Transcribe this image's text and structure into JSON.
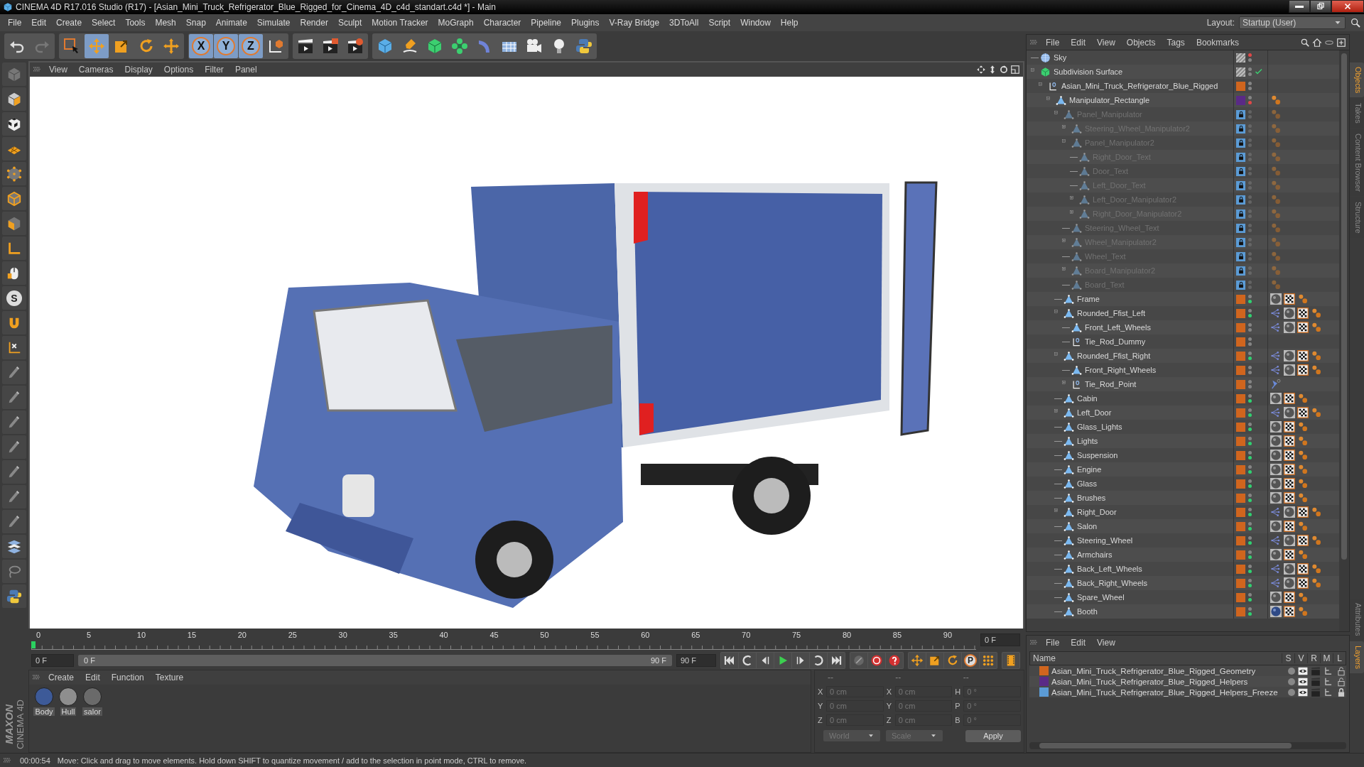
{
  "window": {
    "title": "CINEMA 4D R17.016 Studio (R17) - [Asian_Mini_Truck_Refrigerator_Blue_Rigged_for_Cinema_4D_c4d_standart.c4d *] - Main"
  },
  "menu": [
    "File",
    "Edit",
    "Create",
    "Select",
    "Tools",
    "Mesh",
    "Snap",
    "Animate",
    "Simulate",
    "Render",
    "Sculpt",
    "Motion Tracker",
    "MoGraph",
    "Character",
    "Pipeline",
    "Plugins",
    "V-Ray Bridge",
    "3DToAll",
    "Script",
    "Window",
    "Help"
  ],
  "layout": {
    "label": "Layout:",
    "value": "Startup (User)"
  },
  "toolbar": [
    {
      "kind": "undo",
      "selected": false
    },
    {
      "kind": "redo",
      "selected": false
    },
    {
      "kind": "select",
      "selected": false
    },
    {
      "kind": "move",
      "selected": true
    },
    {
      "kind": "scale",
      "selected": false
    },
    {
      "kind": "rotate",
      "selected": false
    },
    {
      "kind": "transform",
      "selected": false
    },
    {
      "kind": "axis",
      "label": "X",
      "selected": true
    },
    {
      "kind": "axis",
      "label": "Y",
      "selected": true
    },
    {
      "kind": "axis",
      "label": "Z",
      "selected": true
    },
    {
      "kind": "coord",
      "selected": false
    },
    {
      "kind": "render",
      "selected": false
    },
    {
      "kind": "render_view",
      "selected": false
    },
    {
      "kind": "render_settings",
      "selected": false
    },
    {
      "kind": "cube",
      "selected": false
    },
    {
      "kind": "pen",
      "selected": false
    },
    {
      "kind": "subdiv",
      "selected": false
    },
    {
      "kind": "cloner",
      "selected": false
    },
    {
      "kind": "bend",
      "selected": false
    },
    {
      "kind": "floor",
      "selected": false
    },
    {
      "kind": "camera",
      "selected": false
    },
    {
      "kind": "light",
      "selected": false
    },
    {
      "kind": "python",
      "selected": false
    }
  ],
  "left_tools": [
    {
      "kind": "grey_cube"
    },
    {
      "kind": "model"
    },
    {
      "kind": "texture"
    },
    {
      "kind": "workplane"
    },
    {
      "kind": "points"
    },
    {
      "kind": "edges"
    },
    {
      "kind": "polygons"
    },
    {
      "kind": "axis_l"
    },
    {
      "kind": "mouse"
    },
    {
      "kind": "solo",
      "label": "S"
    },
    {
      "kind": "magnet"
    },
    {
      "kind": "axis_lock"
    },
    {
      "kind": "brush"
    },
    {
      "kind": "brush"
    },
    {
      "kind": "brush"
    },
    {
      "kind": "brush"
    },
    {
      "kind": "brush"
    },
    {
      "kind": "brush"
    },
    {
      "kind": "brush"
    },
    {
      "kind": "checker_grid"
    },
    {
      "kind": "lasso"
    },
    {
      "kind": "python"
    }
  ],
  "viewport": {
    "menu": [
      "View",
      "Cameras",
      "Display",
      "Options",
      "Filter",
      "Panel"
    ]
  },
  "timeline": {
    "ticks": [
      "0",
      "5",
      "10",
      "15",
      "20",
      "25",
      "30",
      "35",
      "40",
      "45",
      "50",
      "55",
      "60",
      "65",
      "70",
      "75",
      "80",
      "85",
      "90"
    ],
    "level": 0,
    "frame": "0 F"
  },
  "transport": {
    "start": "0 F",
    "range": {
      "start": "0 F",
      "end": "90 F",
      "level": 1
    },
    "end": "90 F",
    "buttons": [
      {
        "kind": "first"
      },
      {
        "kind": "prev_key"
      },
      {
        "kind": "prev"
      },
      {
        "kind": "play"
      },
      {
        "kind": "next"
      },
      {
        "kind": "next_key"
      },
      {
        "kind": "last"
      },
      {
        "kind": "record_off"
      },
      {
        "kind": "record"
      },
      {
        "kind": "autokey"
      },
      {
        "kind": "move"
      },
      {
        "kind": "scale"
      },
      {
        "kind": "rotate"
      },
      {
        "kind": "param",
        "label": "P"
      },
      {
        "kind": "grid_dots"
      },
      {
        "kind": "film"
      }
    ]
  },
  "materials": {
    "menu": [
      "Create",
      "Edit",
      "Function",
      "Texture"
    ],
    "items": [
      {
        "name": "Body",
        "color": "#3d5a98"
      },
      {
        "name": "Hull",
        "color": "#8e8e8e"
      },
      {
        "name": "salor",
        "color": "#6a6a6a"
      }
    ]
  },
  "coordinates": {
    "headers": [
      "--",
      "--",
      "--"
    ],
    "rows": [
      [
        {
          "label": "X",
          "value": "0 cm"
        },
        {
          "label": "X",
          "value": "0 cm"
        },
        {
          "label": "H",
          "value": "0 °"
        }
      ],
      [
        {
          "label": "Y",
          "value": "0 cm"
        },
        {
          "label": "Y",
          "value": "0 cm"
        },
        {
          "label": "P",
          "value": "0 °"
        }
      ],
      [
        {
          "label": "Z",
          "value": "0 cm"
        },
        {
          "label": "Z",
          "value": "0 cm"
        },
        {
          "label": "B",
          "value": "0 °"
        }
      ]
    ],
    "modes": [
      "World",
      "Scale"
    ],
    "apply": "Apply"
  },
  "objects": {
    "menu": [
      "File",
      "Edit",
      "View",
      "Objects",
      "Tags",
      "Bookmarks"
    ],
    "tree": [
      {
        "name": "Sky",
        "kind": "sky",
        "disabled": false,
        "editor_off": true,
        "render_on": false,
        "render_off": false
      },
      {
        "name": "Subdivision Surface",
        "kind": "subdiv",
        "expanded": true,
        "disabled": false,
        "editor_off": false,
        "render_on": false,
        "render_off": false,
        "children": [
          {
            "name": "Asian_Mini_Truck_Refrigerator_Blue_Rigged",
            "kind": "null",
            "expanded": true,
            "color": "#d0651e",
            "disabled": false,
            "editor_off": false,
            "render_on": false,
            "render_off": false,
            "children": [
              {
                "name": "Manipulator_Rectangle",
                "kind": "polygon",
                "expanded": true,
                "color": "#5a2a86",
                "disabled": false,
                "editor_off": false,
                "render_on": false,
                "render_off": true,
                "tags": [
                  {
                    "kind": "balls"
                  }
                ],
                "children": [
                  {
                    "name": "Panel_Manipulator",
                    "kind": "polygon",
                    "expanded": true,
                    "color": "#5b9bd5",
                    "disabled": true,
                    "editor_off": false,
                    "render_on": false,
                    "render_off": false,
                    "tags": [
                      {
                        "kind": "balls"
                      }
                    ],
                    "children": [
                      {
                        "name": "Steering_Wheel_Manipulator2",
                        "kind": "polygon",
                        "expanded": false,
                        "color": "#5b9bd5",
                        "disabled": true,
                        "editor_off": false,
                        "render_on": false,
                        "render_off": false,
                        "tags": [
                          {
                            "kind": "balls"
                          }
                        ]
                      },
                      {
                        "name": "Panel_Manipulator2",
                        "kind": "polygon",
                        "expanded": true,
                        "color": "#5b9bd5",
                        "disabled": true,
                        "editor_off": false,
                        "render_on": false,
                        "render_off": false,
                        "tags": [
                          {
                            "kind": "balls"
                          }
                        ],
                        "children": [
                          {
                            "name": "Right_Door_Text",
                            "kind": "polygon",
                            "color": "#5b9bd5",
                            "disabled": true,
                            "editor_off": false,
                            "render_on": false,
                            "render_off": false,
                            "tags": [
                              {
                                "kind": "balls"
                              }
                            ]
                          },
                          {
                            "name": "Door_Text",
                            "kind": "polygon",
                            "color": "#5b9bd5",
                            "disabled": true,
                            "editor_off": false,
                            "render_on": false,
                            "render_off": false,
                            "tags": [
                              {
                                "kind": "balls"
                              }
                            ]
                          },
                          {
                            "name": "Left_Door_Text",
                            "kind": "polygon",
                            "color": "#5b9bd5",
                            "disabled": true,
                            "editor_off": false,
                            "render_on": false,
                            "render_off": false,
                            "tags": [
                              {
                                "kind": "balls"
                              }
                            ]
                          },
                          {
                            "name": "Left_Door_Manipulator2",
                            "kind": "polygon",
                            "expanded": false,
                            "color": "#5b9bd5",
                            "disabled": true,
                            "editor_off": false,
                            "render_on": false,
                            "render_off": false,
                            "tags": [
                              {
                                "kind": "balls"
                              }
                            ]
                          },
                          {
                            "name": "Right_Door_Manipulator2",
                            "kind": "polygon",
                            "expanded": false,
                            "color": "#5b9bd5",
                            "disabled": true,
                            "editor_off": false,
                            "render_on": false,
                            "render_off": false,
                            "tags": [
                              {
                                "kind": "balls"
                              }
                            ]
                          }
                        ]
                      },
                      {
                        "name": "Steering_Wheel_Text",
                        "kind": "polygon",
                        "color": "#5b9bd5",
                        "disabled": true,
                        "editor_off": false,
                        "render_on": false,
                        "render_off": false,
                        "tags": [
                          {
                            "kind": "balls"
                          }
                        ]
                      },
                      {
                        "name": "Wheel_Manipulator2",
                        "kind": "polygon",
                        "expanded": false,
                        "color": "#5b9bd5",
                        "disabled": true,
                        "editor_off": false,
                        "render_on": false,
                        "render_off": false,
                        "tags": [
                          {
                            "kind": "balls"
                          }
                        ]
                      },
                      {
                        "name": "Wheel_Text",
                        "kind": "polygon",
                        "color": "#5b9bd5",
                        "disabled": true,
                        "editor_off": false,
                        "render_on": false,
                        "render_off": false,
                        "tags": [
                          {
                            "kind": "balls"
                          }
                        ]
                      },
                      {
                        "name": "Board_Manipulator2",
                        "kind": "polygon",
                        "expanded": false,
                        "color": "#5b9bd5",
                        "disabled": true,
                        "editor_off": false,
                        "render_on": false,
                        "render_off": false,
                        "tags": [
                          {
                            "kind": "balls"
                          }
                        ]
                      },
                      {
                        "name": "Board_Text",
                        "kind": "polygon",
                        "color": "#5b9bd5",
                        "disabled": true,
                        "editor_off": false,
                        "render_on": false,
                        "render_off": false,
                        "tags": [
                          {
                            "kind": "balls"
                          }
                        ]
                      }
                    ]
                  },
                  {
                    "name": "Frame",
                    "kind": "polygon",
                    "color": "#d0651e",
                    "disabled": false,
                    "editor_off": false,
                    "render_on": true,
                    "render_off": false,
                    "tags": [
                      {
                        "kind": "material"
                      },
                      {
                        "kind": "texture"
                      },
                      {
                        "kind": "balls"
                      }
                    ]
                  },
                  {
                    "name": "Rounded_Ffist_Left",
                    "kind": "polygon",
                    "expanded": true,
                    "color": "#d0651e",
                    "disabled": false,
                    "editor_off": false,
                    "render_on": true,
                    "render_off": false,
                    "tags": [
                      {
                        "kind": "weight"
                      },
                      {
                        "kind": "material"
                      },
                      {
                        "kind": "texture"
                      },
                      {
                        "kind": "balls"
                      }
                    ],
                    "children": [
                      {
                        "name": "Front_Left_Wheels",
                        "kind": "polygon",
                        "color": "#d0651e",
                        "disabled": false,
                        "editor_off": false,
                        "render_on": false,
                        "render_off": false,
                        "tags": [
                          {
                            "kind": "weight"
                          },
                          {
                            "kind": "material"
                          },
                          {
                            "kind": "texture"
                          },
                          {
                            "kind": "balls"
                          }
                        ]
                      },
                      {
                        "name": "Tie_Rod_Dummy",
                        "kind": "null",
                        "color": "#d0651e",
                        "disabled": false,
                        "editor_off": false,
                        "render_on": false,
                        "render_off": false
                      }
                    ]
                  },
                  {
                    "name": "Rounded_Ffist_Right",
                    "kind": "polygon",
                    "expanded": true,
                    "color": "#d0651e",
                    "disabled": false,
                    "editor_off": false,
                    "render_on": true,
                    "render_off": false,
                    "tags": [
                      {
                        "kind": "weight"
                      },
                      {
                        "kind": "material"
                      },
                      {
                        "kind": "texture"
                      },
                      {
                        "kind": "balls"
                      }
                    ],
                    "children": [
                      {
                        "name": "Front_Right_Wheels",
                        "kind": "polygon",
                        "color": "#d0651e",
                        "disabled": false,
                        "editor_off": false,
                        "render_on": false,
                        "render_off": false,
                        "tags": [
                          {
                            "kind": "weight"
                          },
                          {
                            "kind": "material"
                          },
                          {
                            "kind": "texture"
                          },
                          {
                            "kind": "balls"
                          }
                        ]
                      },
                      {
                        "name": "Tie_Rod_Point",
                        "kind": "null",
                        "expanded": false,
                        "color": "#d0651e",
                        "disabled": false,
                        "editor_off": false,
                        "render_on": false,
                        "render_off": false,
                        "tags": [
                          {
                            "kind": "pin"
                          }
                        ]
                      }
                    ]
                  },
                  {
                    "name": "Cabin",
                    "kind": "polygon",
                    "color": "#d0651e",
                    "disabled": false,
                    "editor_off": false,
                    "render_on": true,
                    "render_off": false,
                    "tags": [
                      {
                        "kind": "material"
                      },
                      {
                        "kind": "texture"
                      },
                      {
                        "kind": "balls"
                      }
                    ]
                  },
                  {
                    "name": "Left_Door",
                    "kind": "polygon",
                    "expanded": false,
                    "color": "#d0651e",
                    "disabled": false,
                    "editor_off": false,
                    "render_on": true,
                    "render_off": false,
                    "tags": [
                      {
                        "kind": "weight"
                      },
                      {
                        "kind": "material"
                      },
                      {
                        "kind": "texture"
                      },
                      {
                        "kind": "balls"
                      }
                    ]
                  },
                  {
                    "name": "Glass_Lights",
                    "kind": "polygon",
                    "color": "#d0651e",
                    "disabled": false,
                    "editor_off": false,
                    "render_on": true,
                    "render_off": false,
                    "tags": [
                      {
                        "kind": "material"
                      },
                      {
                        "kind": "texture"
                      },
                      {
                        "kind": "balls"
                      }
                    ]
                  },
                  {
                    "name": "Lights",
                    "kind": "polygon",
                    "color": "#d0651e",
                    "disabled": false,
                    "editor_off": false,
                    "render_on": true,
                    "render_off": false,
                    "tags": [
                      {
                        "kind": "material"
                      },
                      {
                        "kind": "texture"
                      },
                      {
                        "kind": "balls"
                      }
                    ]
                  },
                  {
                    "name": "Suspension",
                    "kind": "polygon",
                    "color": "#d0651e",
                    "disabled": false,
                    "editor_off": false,
                    "render_on": true,
                    "render_off": false,
                    "tags": [
                      {
                        "kind": "material"
                      },
                      {
                        "kind": "texture"
                      },
                      {
                        "kind": "balls"
                      }
                    ]
                  },
                  {
                    "name": "Engine",
                    "kind": "polygon",
                    "color": "#d0651e",
                    "disabled": false,
                    "editor_off": false,
                    "render_on": true,
                    "render_off": false,
                    "tags": [
                      {
                        "kind": "material"
                      },
                      {
                        "kind": "texture"
                      },
                      {
                        "kind": "balls"
                      }
                    ]
                  },
                  {
                    "name": "Glass",
                    "kind": "polygon",
                    "color": "#d0651e",
                    "disabled": false,
                    "editor_off": false,
                    "render_on": true,
                    "render_off": false,
                    "tags": [
                      {
                        "kind": "material"
                      },
                      {
                        "kind": "texture"
                      },
                      {
                        "kind": "balls"
                      }
                    ]
                  },
                  {
                    "name": "Brushes",
                    "kind": "polygon",
                    "color": "#d0651e",
                    "disabled": false,
                    "editor_off": false,
                    "render_on": true,
                    "render_off": false,
                    "tags": [
                      {
                        "kind": "material"
                      },
                      {
                        "kind": "texture"
                      },
                      {
                        "kind": "balls"
                      }
                    ]
                  },
                  {
                    "name": "Right_Door",
                    "kind": "polygon",
                    "expanded": false,
                    "color": "#d0651e",
                    "disabled": false,
                    "editor_off": false,
                    "render_on": true,
                    "render_off": false,
                    "tags": [
                      {
                        "kind": "weight"
                      },
                      {
                        "kind": "material"
                      },
                      {
                        "kind": "texture"
                      },
                      {
                        "kind": "balls"
                      }
                    ]
                  },
                  {
                    "name": "Salon",
                    "kind": "polygon",
                    "color": "#d0651e",
                    "disabled": false,
                    "editor_off": false,
                    "render_on": true,
                    "render_off": false,
                    "tags": [
                      {
                        "kind": "material"
                      },
                      {
                        "kind": "texture"
                      },
                      {
                        "kind": "balls"
                      }
                    ]
                  },
                  {
                    "name": "Steering_Wheel",
                    "kind": "polygon",
                    "color": "#d0651e",
                    "disabled": false,
                    "editor_off": false,
                    "render_on": true,
                    "render_off": false,
                    "tags": [
                      {
                        "kind": "weight"
                      },
                      {
                        "kind": "material"
                      },
                      {
                        "kind": "texture"
                      },
                      {
                        "kind": "balls"
                      }
                    ]
                  },
                  {
                    "name": "Armchairs",
                    "kind": "polygon",
                    "color": "#d0651e",
                    "disabled": false,
                    "editor_off": false,
                    "render_on": true,
                    "render_off": false,
                    "tags": [
                      {
                        "kind": "material"
                      },
                      {
                        "kind": "texture"
                      },
                      {
                        "kind": "balls"
                      }
                    ]
                  },
                  {
                    "name": "Back_Left_Wheels",
                    "kind": "polygon",
                    "color": "#d0651e",
                    "disabled": false,
                    "editor_off": false,
                    "render_on": true,
                    "render_off": false,
                    "tags": [
                      {
                        "kind": "weight"
                      },
                      {
                        "kind": "material"
                      },
                      {
                        "kind": "texture"
                      },
                      {
                        "kind": "balls"
                      }
                    ]
                  },
                  {
                    "name": "Back_Right_Wheels",
                    "kind": "polygon",
                    "color": "#d0651e",
                    "disabled": false,
                    "editor_off": false,
                    "render_on": true,
                    "render_off": false,
                    "tags": [
                      {
                        "kind": "weight"
                      },
                      {
                        "kind": "material"
                      },
                      {
                        "kind": "texture"
                      },
                      {
                        "kind": "balls"
                      }
                    ]
                  },
                  {
                    "name": "Spare_Wheel",
                    "kind": "polygon",
                    "color": "#d0651e",
                    "disabled": false,
                    "editor_off": false,
                    "render_on": true,
                    "render_off": false,
                    "tags": [
                      {
                        "kind": "material"
                      },
                      {
                        "kind": "texture"
                      },
                      {
                        "kind": "balls"
                      }
                    ]
                  },
                  {
                    "name": "Booth",
                    "kind": "polygon",
                    "color": "#d0651e",
                    "disabled": false,
                    "editor_off": false,
                    "render_on": true,
                    "render_off": false,
                    "tags": [
                      {
                        "kind": "material_blue"
                      },
                      {
                        "kind": "texture"
                      },
                      {
                        "kind": "balls"
                      }
                    ]
                  }
                ]
              }
            ]
          }
        ]
      }
    ]
  },
  "layers": {
    "menu": [
      "File",
      "Edit",
      "View"
    ],
    "columns": [
      "Name",
      "S",
      "V",
      "R",
      "M",
      "L"
    ],
    "items": [
      {
        "name": "Asian_Mini_Truck_Refrigerator_Blue_Rigged_Geometry",
        "color": "#d0651e",
        "locked": false
      },
      {
        "name": "Asian_Mini_Truck_Refrigerator_Blue_Rigged_Helpers",
        "color": "#5a2a86",
        "locked": false
      },
      {
        "name": "Asian_Mini_Truck_Refrigerator_Blue_Rigged_Helpers_Freeze",
        "color": "#5b9bd5",
        "locked": true
      }
    ]
  },
  "right_tabs_top": [
    {
      "label": "Objects",
      "selected": true
    },
    {
      "label": "Takes",
      "selected": false
    },
    {
      "label": "Content Browser",
      "selected": false
    },
    {
      "label": "Structure",
      "selected": false
    }
  ],
  "right_tabs_bottom": [
    {
      "label": "Attributes",
      "selected": false
    },
    {
      "label": "Layers",
      "selected": true
    }
  ],
  "logo": {
    "brand": "MAXON",
    "product": "CINEMA 4D"
  },
  "status": {
    "time": "00:00:54",
    "message": "Move: Click and drag to move elements. Hold down SHIFT to quantize movement / add to the selection in point mode, CTRL to remove."
  }
}
